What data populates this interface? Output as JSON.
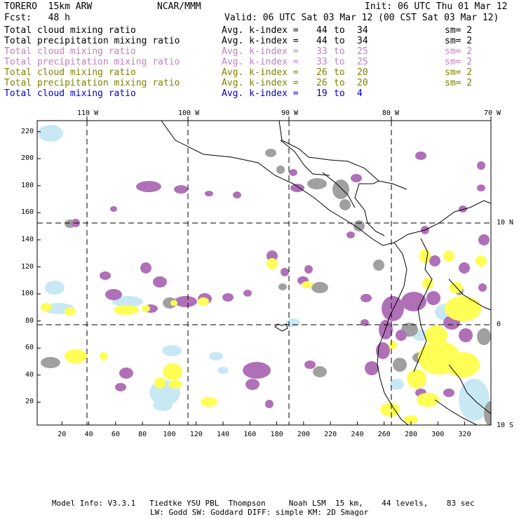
{
  "header": {
    "model": "TORERO  15km ARW",
    "org": "NCAR/MMM",
    "init": "Init: 06 UTC Thu 01 Mar 12",
    "fcst": "Fcst:   48 h",
    "valid": "Valid: 06 UTC Sat 03 Mar 12 (00 CST Sat 03 Mar 12)"
  },
  "legend": [
    {
      "label": "Total cloud mixing ratio",
      "avg": "Avg. k-index =",
      "hi": "44",
      "to": "to",
      "lo": "34",
      "sm": "sm= 2",
      "color": "#000000"
    },
    {
      "label": "Total precipitation mixing ratio",
      "avg": "Avg. k-index =",
      "hi": "44",
      "to": "to",
      "lo": "34",
      "sm": "sm= 2",
      "color": "#000000"
    },
    {
      "label": "Total cloud mixing ratio",
      "avg": "Avg. k-index =",
      "hi": "33",
      "to": "to",
      "lo": "25",
      "sm": "sm= 2",
      "color": "#c080c0"
    },
    {
      "label": "Total precipitation mixing ratio",
      "avg": "Avg. k-index =",
      "hi": "33",
      "to": "to",
      "lo": "25",
      "sm": "sm= 2",
      "color": "#c080c0"
    },
    {
      "label": "Total cloud mixing ratio",
      "avg": "Avg. k-index =",
      "hi": "26",
      "to": "to",
      "lo": "20",
      "sm": "sm= 2",
      "color": "#808000"
    },
    {
      "label": "Total precipitation mixing ratio",
      "avg": "Avg. k-index =",
      "hi": "26",
      "to": "to",
      "lo": "20",
      "sm": "sm= 2",
      "color": "#808000"
    },
    {
      "label": "Total cloud mixing ratio",
      "avg": "Avg. k-index =",
      "hi": "19",
      "to": "to",
      "lo": "4",
      "sm": "",
      "color": "#0000cc"
    }
  ],
  "axes": {
    "lon_labels": [
      "110 W",
      "100 W",
      "90 W",
      "80 W",
      "70 W"
    ],
    "lat_labels": [
      "10 N",
      "0",
      "10 S"
    ],
    "x_ticks": [
      "20",
      "40",
      "60",
      "80",
      "100",
      "120",
      "140",
      "160",
      "180",
      "200",
      "220",
      "240",
      "260",
      "280",
      "300",
      "320"
    ],
    "y_ticks": [
      "20",
      "40",
      "60",
      "80",
      "100",
      "120",
      "140",
      "160",
      "180",
      "200",
      "220"
    ]
  },
  "colors": {
    "purple": "#b070b8",
    "yellow": "#ffff55",
    "gray": "#a0a0a0",
    "lightblue": "#c8e8f4"
  },
  "footer": {
    "line1": "Model Info: V3.3.1   Tiedtke YSU PBL  Thompson     Noah LSM  15 km,    44 levels,    83 sec",
    "line2": "LW: Godd SW: Goddard DIFF: simple KM: 2D Smagor"
  }
}
